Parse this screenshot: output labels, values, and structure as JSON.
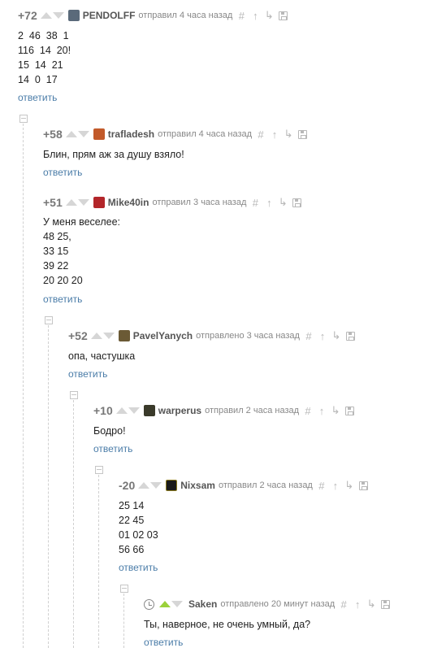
{
  "comments": [
    {
      "rating": "+72",
      "author": "PENDOLFF",
      "when": "отправил 4 часа назад",
      "lines": [
        "2  46  38  1",
        "116  14  20!",
        "15  14  21",
        "14  0  17"
      ],
      "reply": "ответить",
      "avatar_color": "#5a6a7a"
    },
    {
      "rating": "+58",
      "author": "trafladesh",
      "when": "отправил 4 часа назад",
      "lines": [
        "Блин, прям аж за душу взяло!"
      ],
      "reply": "ответить",
      "avatar_color": "#c25a2a"
    },
    {
      "rating": "+51",
      "author": "Mike40in",
      "when": "отправил 3 часа назад",
      "lines": [
        "У меня веселее:",
        "48 25,",
        "33 15",
        "39 22",
        "20 20 20"
      ],
      "reply": "ответить",
      "avatar_color": "#b3262a"
    },
    {
      "rating": "+52",
      "author": "PavelYanych",
      "when": "отправлено 3 часа назад",
      "lines": [
        "опа, частушка"
      ],
      "reply": "ответить",
      "avatar_color": "#6b5a35"
    },
    {
      "rating": "+10",
      "author": "warperus",
      "when": "отправил 2 часа назад",
      "lines": [
        "Бодро!"
      ],
      "reply": "ответить",
      "avatar_color": "#3a3a2a"
    },
    {
      "rating": "-20",
      "author": "Nixsam",
      "when": "отправил 2 часа назад",
      "lines": [
        "25 14",
        "22 45",
        "01 02 03",
        "56 66"
      ],
      "reply": "ответить",
      "avatar_color": "#1a1a1a"
    },
    {
      "rating": "",
      "author": "Saken",
      "when": "отправлено 20 минут назад",
      "lines": [
        "Ты, наверное, не очень умный, да?"
      ],
      "reply": "ответить",
      "avatar_color": ""
    }
  ],
  "icons": {
    "hash": "#",
    "up_link": "↑",
    "reply_link": "↳"
  },
  "colors": {
    "reply_link": "#4a7ca8",
    "upvote_active": "#9bd13b",
    "arrow_inactive": "#d6d6d6"
  }
}
